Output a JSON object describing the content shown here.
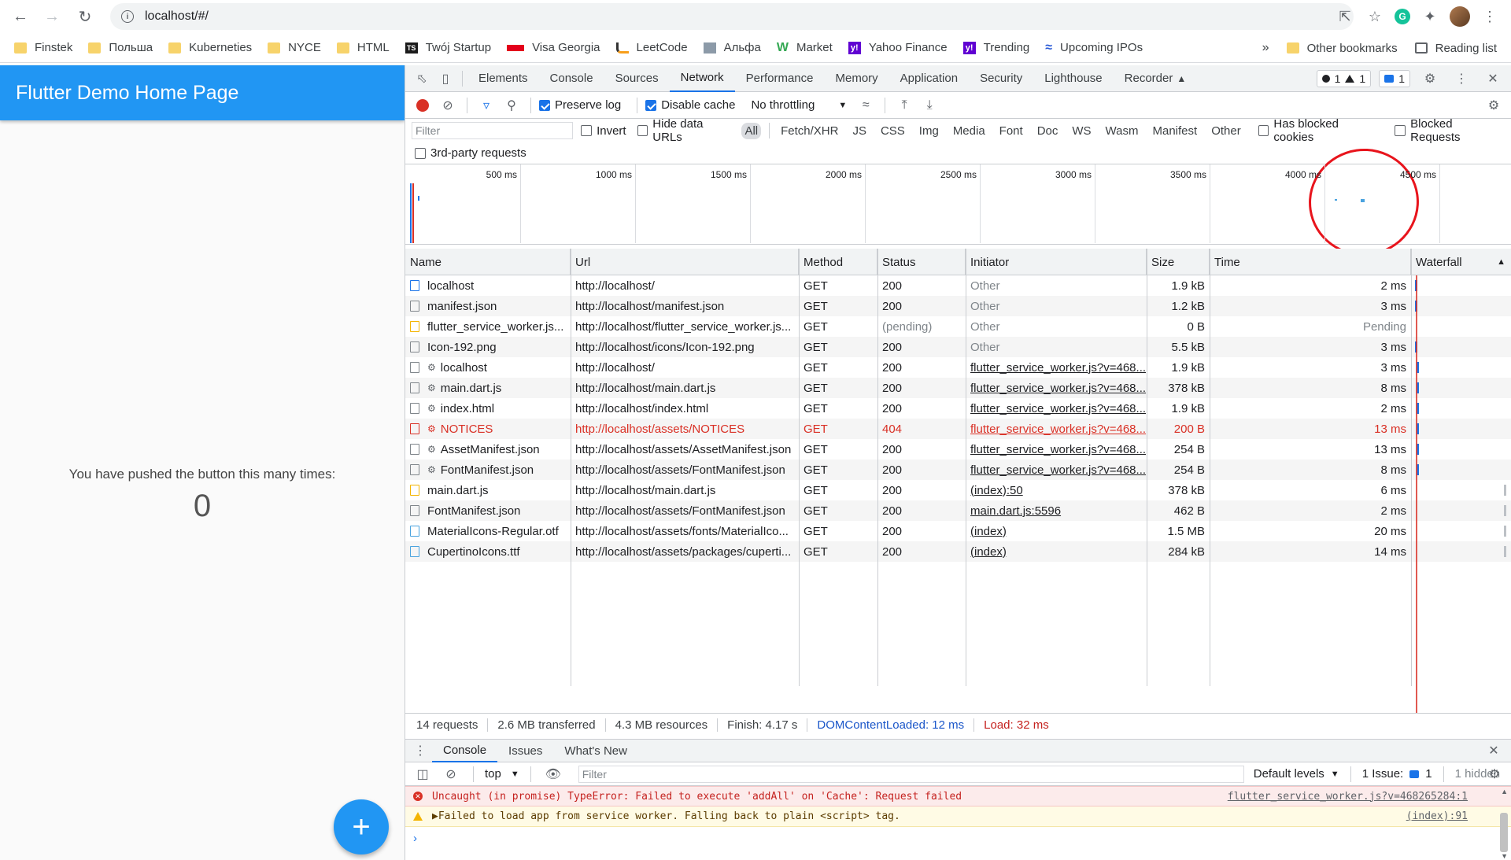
{
  "browser": {
    "url": "localhost/#/",
    "bookmarks": [
      "Finstek",
      "Польша",
      "Kuberneties",
      "NYCE",
      "HTML",
      "Twój Startup",
      "Visa Georgia",
      "LeetCode",
      "Альфа",
      "Market",
      "Yahoo Finance",
      "Trending",
      "Upcoming IPOs"
    ],
    "more": "»",
    "other_bookmarks": "Other bookmarks",
    "reading_list": "Reading list"
  },
  "app": {
    "title": "Flutter Demo Home Page",
    "counter_label": "You have pushed the button this many times:",
    "counter_value": "0",
    "fab_icon": "+"
  },
  "devtools": {
    "tabs": [
      "Elements",
      "Console",
      "Sources",
      "Network",
      "Performance",
      "Memory",
      "Application",
      "Security",
      "Lighthouse",
      "Recorder"
    ],
    "active_tab": "Network",
    "badges": {
      "errors": "1",
      "warnings": "1",
      "messages": "1"
    },
    "toolbar": {
      "preserve_log": "Preserve log",
      "disable_cache": "Disable cache",
      "throttling": "No throttling"
    },
    "filter": {
      "placeholder": "Filter",
      "invert": "Invert",
      "hide_data_urls": "Hide data URLs",
      "types": [
        "All",
        "Fetch/XHR",
        "JS",
        "CSS",
        "Img",
        "Media",
        "Font",
        "Doc",
        "WS",
        "Wasm",
        "Manifest",
        "Other"
      ],
      "has_blocked_cookies": "Has blocked cookies",
      "blocked_requests": "Blocked Requests",
      "third_party": "3rd-party requests"
    },
    "timeline_ticks": [
      "500 ms",
      "1000 ms",
      "1500 ms",
      "2000 ms",
      "2500 ms",
      "3000 ms",
      "3500 ms",
      "4000 ms",
      "4500 ms"
    ],
    "columns": [
      "Name",
      "Url",
      "Method",
      "Status",
      "Initiator",
      "Size",
      "Time",
      "Waterfall"
    ],
    "requests": [
      {
        "icon": "doc",
        "sw": false,
        "name": "localhost",
        "url": "http://localhost/",
        "method": "GET",
        "status": "200",
        "initiator": "Other",
        "init_link": false,
        "size": "1.9 kB",
        "time": "2 ms",
        "error": false
      },
      {
        "icon": "file",
        "sw": false,
        "name": "manifest.json",
        "url": "http://localhost/manifest.json",
        "method": "GET",
        "status": "200",
        "initiator": "Other",
        "init_link": false,
        "size": "1.2 kB",
        "time": "3 ms",
        "error": false
      },
      {
        "icon": "script",
        "sw": false,
        "name": "flutter_service_worker.js...",
        "url": "http://localhost/flutter_service_worker.js...",
        "method": "GET",
        "status": "(pending)",
        "initiator": "Other",
        "init_link": false,
        "size": "0 B",
        "time": "Pending",
        "error": false
      },
      {
        "icon": "file",
        "sw": false,
        "name": "Icon-192.png",
        "url": "http://localhost/icons/Icon-192.png",
        "method": "GET",
        "status": "200",
        "initiator": "Other",
        "init_link": false,
        "size": "5.5 kB",
        "time": "3 ms",
        "error": false
      },
      {
        "icon": "file",
        "sw": true,
        "name": "localhost",
        "url": "http://localhost/",
        "method": "GET",
        "status": "200",
        "initiator": "flutter_service_worker.js?v=468...",
        "init_link": true,
        "size": "1.9 kB",
        "time": "3 ms",
        "error": false
      },
      {
        "icon": "file",
        "sw": true,
        "name": "main.dart.js",
        "url": "http://localhost/main.dart.js",
        "method": "GET",
        "status": "200",
        "initiator": "flutter_service_worker.js?v=468...",
        "init_link": true,
        "size": "378 kB",
        "time": "8 ms",
        "error": false
      },
      {
        "icon": "file",
        "sw": true,
        "name": "index.html",
        "url": "http://localhost/index.html",
        "method": "GET",
        "status": "200",
        "initiator": "flutter_service_worker.js?v=468...",
        "init_link": true,
        "size": "1.9 kB",
        "time": "2 ms",
        "error": false
      },
      {
        "icon": "err",
        "sw": true,
        "name": "NOTICES",
        "url": "http://localhost/assets/NOTICES",
        "method": "GET",
        "status": "404",
        "initiator": "flutter_service_worker.js?v=468...",
        "init_link": true,
        "size": "200 B",
        "time": "13 ms",
        "error": true
      },
      {
        "icon": "file",
        "sw": true,
        "name": "AssetManifest.json",
        "url": "http://localhost/assets/AssetManifest.json",
        "method": "GET",
        "status": "200",
        "initiator": "flutter_service_worker.js?v=468...",
        "init_link": true,
        "size": "254 B",
        "time": "13 ms",
        "error": false
      },
      {
        "icon": "file",
        "sw": true,
        "name": "FontManifest.json",
        "url": "http://localhost/assets/FontManifest.json",
        "method": "GET",
        "status": "200",
        "initiator": "flutter_service_worker.js?v=468...",
        "init_link": true,
        "size": "254 B",
        "time": "8 ms",
        "error": false
      },
      {
        "icon": "script",
        "sw": false,
        "name": "main.dart.js",
        "url": "http://localhost/main.dart.js",
        "method": "GET",
        "status": "200",
        "initiator": "(index):50",
        "init_link": true,
        "size": "378 kB",
        "time": "6 ms",
        "error": false
      },
      {
        "icon": "file",
        "sw": false,
        "name": "FontManifest.json",
        "url": "http://localhost/assets/FontManifest.json",
        "method": "GET",
        "status": "200",
        "initiator": "main.dart.js:5596",
        "init_link": true,
        "size": "462 B",
        "time": "2 ms",
        "error": false
      },
      {
        "icon": "font",
        "sw": false,
        "name": "MaterialIcons-Regular.otf",
        "url": "http://localhost/assets/fonts/MaterialIco...",
        "method": "GET",
        "status": "200",
        "initiator": "(index)",
        "init_link": true,
        "size": "1.5 MB",
        "time": "20 ms",
        "error": false
      },
      {
        "icon": "font",
        "sw": false,
        "name": "CupertinoIcons.ttf",
        "url": "http://localhost/assets/packages/cuperti...",
        "method": "GET",
        "status": "200",
        "initiator": "(index)",
        "init_link": true,
        "size": "284 kB",
        "time": "14 ms",
        "error": false
      }
    ],
    "summary": {
      "requests": "14 requests",
      "transferred": "2.6 MB transferred",
      "resources": "4.3 MB resources",
      "finish": "Finish: 4.17 s",
      "dom_loaded": "DOMContentLoaded: 12 ms",
      "load": "Load: 32 ms"
    },
    "drawer_tabs": [
      "Console",
      "Issues",
      "What's New"
    ],
    "console": {
      "context": "top",
      "filter_placeholder": "Filter",
      "levels": "Default levels",
      "issues": "1 Issue:",
      "issues_count": "1",
      "hidden": "1 hidden",
      "messages": [
        {
          "level": "error",
          "text": "Uncaught (in promise) TypeError: Failed to execute 'addAll' on 'Cache': Request failed",
          "source": "flutter_service_worker.js?v=468265284:1"
        },
        {
          "level": "warning",
          "text": "▶Failed to load app from service worker. Falling back to plain <script> tag.",
          "source": "(index):91"
        }
      ],
      "prompt": "›"
    }
  }
}
